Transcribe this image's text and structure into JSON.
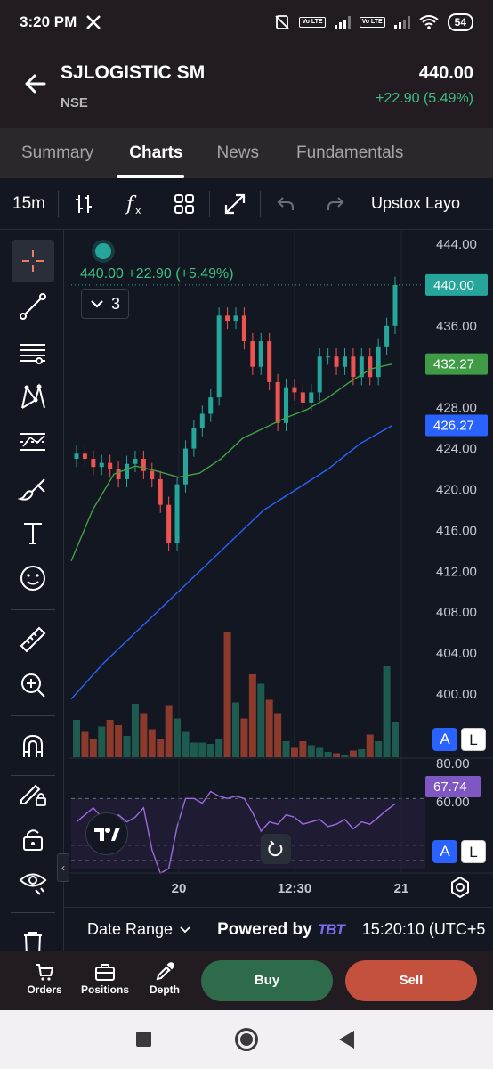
{
  "status": {
    "time": "3:20 PM",
    "battery": "54",
    "volte_label": "Vo LTE"
  },
  "header": {
    "symbol": "SJLOGISTIC SM",
    "exchange": "NSE",
    "price": "440.00",
    "change": "+22.90 (5.49%)"
  },
  "tabs": [
    {
      "label": "Summary",
      "active": false
    },
    {
      "label": "Charts",
      "active": true
    },
    {
      "label": "News",
      "active": false
    },
    {
      "label": "Fundamentals",
      "active": false
    }
  ],
  "chart_toolbar": {
    "timeframe": "15m",
    "layout_label": "Upstox Layo"
  },
  "chart": {
    "ohlc_legend": "440.00  +22.90 (+5.49%)",
    "indicator_count": "3",
    "price_axis": [
      "444.00",
      "440.00",
      "436.00",
      "432.00",
      "428.00",
      "424.00",
      "420.00",
      "416.00",
      "412.00",
      "408.00",
      "404.00",
      "400.00"
    ],
    "price_tags": [
      {
        "label": "440.00",
        "value": 440.0,
        "color": "#26a69a"
      },
      {
        "label": "432.27",
        "value": 432.27,
        "color": "#3f9b46"
      },
      {
        "label": "426.27",
        "value": 426.27,
        "color": "#2962ff"
      }
    ],
    "rsi_axis": [
      "80.00",
      "60.00"
    ],
    "rsi_tag": {
      "label": "67.74",
      "color": "#7e57c2"
    },
    "time_axis": [
      "20",
      "12:30",
      "21"
    ],
    "auto_label": "A",
    "log_label": "L"
  },
  "footer": {
    "date_range_label": "Date Range",
    "powered_by_label": "Powered by",
    "powered_brand": "TBT",
    "clock": "15:20:10 (UTC+5"
  },
  "actions": {
    "orders": "Orders",
    "positions": "Positions",
    "depth": "Depth",
    "buy": "Buy",
    "sell": "Sell"
  },
  "chart_data": {
    "type": "candlestick",
    "ylim": [
      398,
      446
    ],
    "series": [
      {
        "name": "price",
        "values": [
          423.5,
          423.0,
          422.2,
          422.6,
          422.0,
          421.0,
          422.5,
          423.0,
          421.8,
          421.0,
          418.5,
          414.8,
          420.5,
          424.0,
          426.0,
          427.4,
          429.0,
          437.0,
          436.5,
          437.0,
          434.5,
          432.0,
          434.5,
          430.5,
          426.5,
          430.0,
          429.5,
          428.5,
          429.5,
          433.0,
          433.0,
          432.0,
          433.0,
          431.0,
          433.0,
          431.0,
          434.0,
          436.0,
          440.0
        ]
      },
      {
        "name": "green-ma",
        "values": [
          413,
          418,
          421.5,
          422.3,
          421.8,
          421.2,
          421.6,
          423.0,
          425.0,
          426.0,
          427.0,
          427.8,
          429.0,
          430.5,
          431.8,
          432.27
        ]
      },
      {
        "name": "blue-ma",
        "values": [
          399.5,
          403,
          406,
          409,
          412,
          415,
          418,
          420,
          422,
          424.5,
          426.27
        ]
      }
    ],
    "volume_relative": [
      0.28,
      0.19,
      0.14,
      0.23,
      0.28,
      0.24,
      0.16,
      0.4,
      0.33,
      0.21,
      0.14,
      0.39,
      0.29,
      0.19,
      0.11,
      0.11,
      0.1,
      0.14,
      0.94,
      0.41,
      0.29,
      0.62,
      0.55,
      0.43,
      0.33,
      0.12,
      0.07,
      0.12,
      0.09,
      0.07,
      0.04,
      0.03,
      0.02,
      0.05,
      0.06,
      0.17,
      0.12,
      0.68,
      0.26
    ],
    "rsi": [
      60,
      63,
      66,
      62,
      58,
      63,
      60,
      62,
      66,
      48,
      38,
      40,
      58,
      70,
      70,
      68,
      73,
      71,
      70,
      71,
      70,
      64,
      56,
      60,
      59,
      63,
      62,
      59,
      60,
      61,
      58,
      59,
      61,
      57,
      60,
      59,
      62,
      65,
      67.74
    ],
    "rsi_ylim": [
      40,
      85
    ]
  }
}
